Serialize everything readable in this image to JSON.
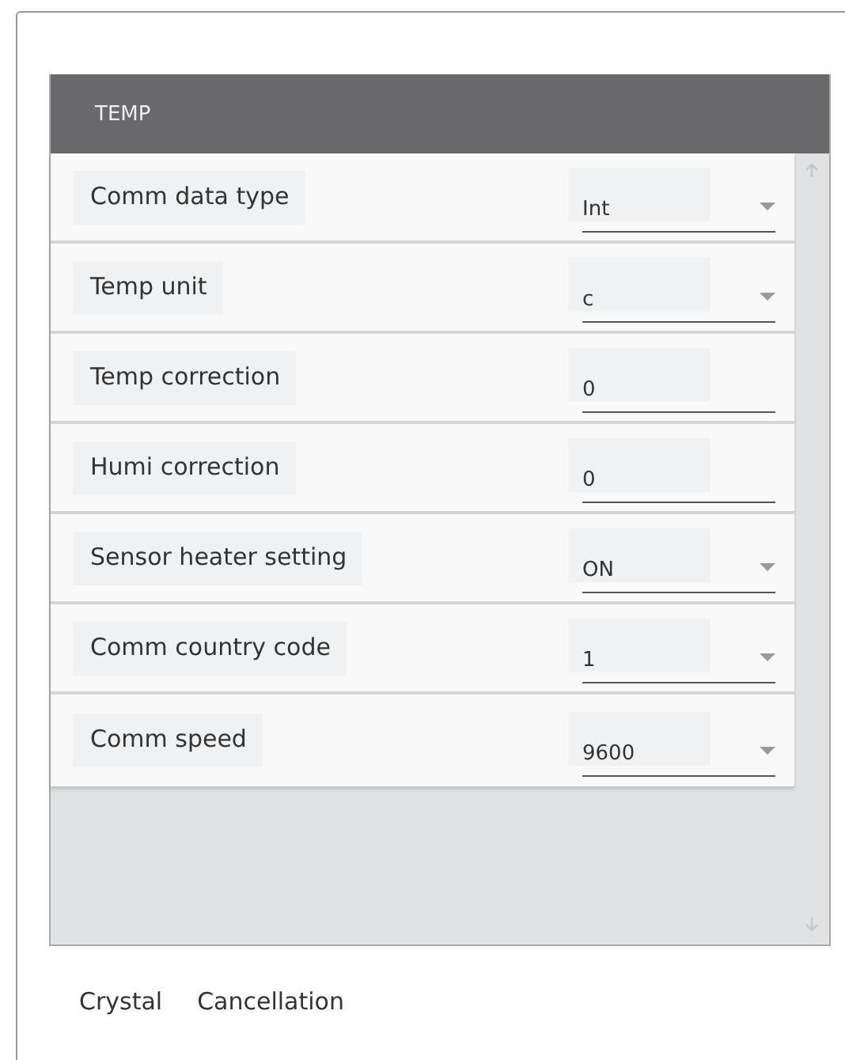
{
  "panel": {
    "title": "TEMP"
  },
  "settings": [
    {
      "label": "Comm data type",
      "kind": "select",
      "value": "Int"
    },
    {
      "label": "Temp unit",
      "kind": "select",
      "value": "c"
    },
    {
      "label": "Temp correction",
      "kind": "text",
      "value": "0"
    },
    {
      "label": "Humi correction",
      "kind": "text",
      "value": "0"
    },
    {
      "label": "Sensor heater setting",
      "kind": "select",
      "value": "ON"
    },
    {
      "label": "Comm country code",
      "kind": "select",
      "value": "1"
    },
    {
      "label": "Comm speed",
      "kind": "select",
      "value": "9600"
    }
  ],
  "buttons": [
    "Crystal",
    "Cancellation"
  ]
}
